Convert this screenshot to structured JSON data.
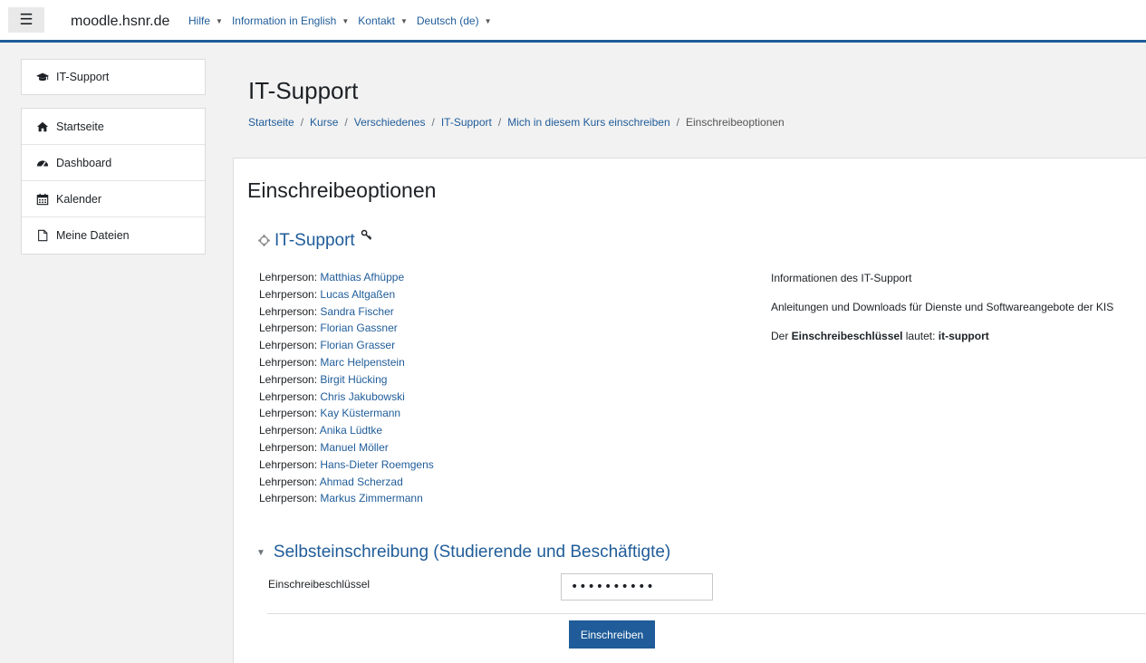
{
  "navbar": {
    "site_name": "moodle.hsnr.de",
    "menu": [
      {
        "label": "Hilfe"
      },
      {
        "label": "Information in English"
      },
      {
        "label": "Kontakt"
      },
      {
        "label": "Deutsch (de)"
      }
    ]
  },
  "drawer": {
    "course": {
      "label": "IT-Support",
      "icon": "graduation-cap-icon"
    },
    "items": [
      {
        "label": "Startseite",
        "icon": "home-icon"
      },
      {
        "label": "Dashboard",
        "icon": "dashboard-icon"
      },
      {
        "label": "Kalender",
        "icon": "calendar-icon"
      },
      {
        "label": "Meine Dateien",
        "icon": "file-icon"
      }
    ]
  },
  "header": {
    "title": "IT-Support",
    "breadcrumb": [
      "Startseite",
      "Kurse",
      "Verschiedenes",
      "IT-Support",
      "Mich in diesem Kurs einschreiben",
      "Einschreibeoptionen"
    ]
  },
  "main": {
    "heading": "Einschreibeoptionen",
    "course_name": "IT-Support",
    "teacher_role": "Lehrperson: ",
    "teachers": [
      "Matthias Afhüppe",
      "Lucas Altgaßen",
      "Sandra Fischer",
      "Florian Gassner",
      "Florian Grasser",
      "Marc Helpenstein",
      "Birgit Hücking",
      "Chris Jakubowski",
      "Kay Küstermann",
      "Anika Lüdtke",
      "Manuel Möller",
      "Hans-Dieter Roemgens",
      "Ahmad Scherzad",
      "Markus Zimmermann"
    ],
    "summary": {
      "line1": "Informationen des IT-Support",
      "line2": "Anleitungen und Downloads für Dienste und Softwareangebote der KIS",
      "key_prefix": "Der ",
      "key_bold": "Einschreibeschlüssel",
      "key_middle": " lautet: ",
      "key_value": "it-support"
    },
    "enrol": {
      "section_title": "Selbsteinschreibung (Studierende und Beschäftigte)",
      "field_label": "Einschreibeschlüssel",
      "field_value": "••••••••••",
      "button_label": "Einschreiben"
    }
  },
  "colors": {
    "brand": "#1f5c99",
    "link": "#1f5c99",
    "background": "#f2f2f2"
  }
}
